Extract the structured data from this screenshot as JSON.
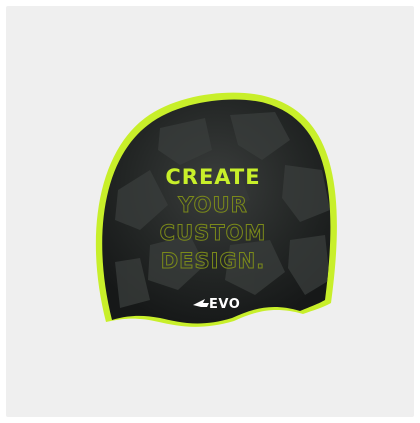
{
  "product": {
    "headline": "CREATE",
    "lines": [
      "YOUR",
      "CUSTOM",
      "DESIGN."
    ],
    "brand": "EVO"
  },
  "colors": {
    "background": "#efefef",
    "cap_dark": "#1d1f1f",
    "cap_camo": "#2e3130",
    "accent": "#c8ef2a",
    "outline_text": "#7b8a1a"
  },
  "icons": {
    "brand_mark": "evo-arrow-icon"
  }
}
